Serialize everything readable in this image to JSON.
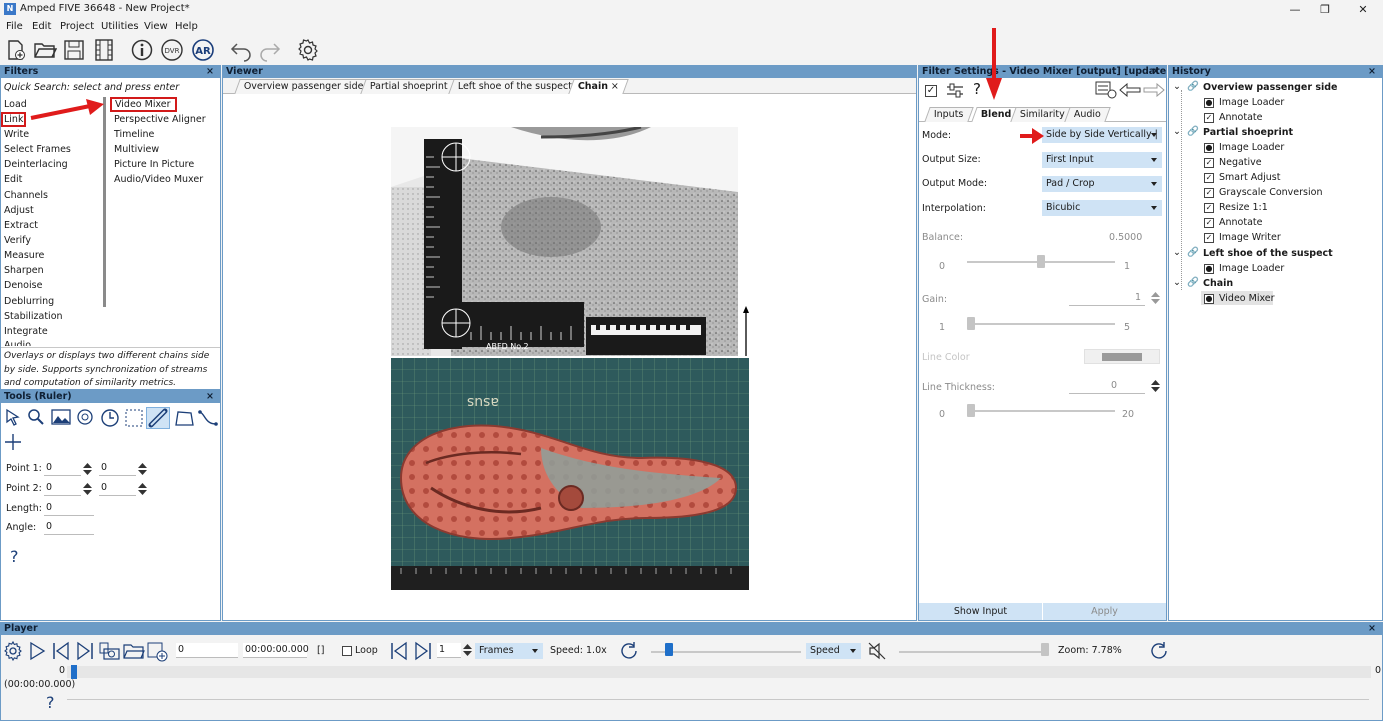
{
  "window": {
    "title": "Amped FIVE 36648 - New Project*",
    "logo_text": "N"
  },
  "menu": [
    "File",
    "Edit",
    "Project",
    "Utilities",
    "View",
    "Help"
  ],
  "toolbar_icons": [
    "new-project-icon",
    "open-icon",
    "save-icon",
    "film-icon",
    "info-icon",
    "dvr-icon",
    "ar-icon",
    "undo-icon",
    "redo-icon",
    "settings-icon"
  ],
  "filters": {
    "title": "Filters",
    "quick_search": "Quick Search: select and press enter",
    "categories": [
      "Load",
      "Link",
      "Write",
      "Select Frames",
      "Deinterlacing",
      "Edit",
      "Channels",
      "Adjust",
      "Extract",
      "Verify",
      "Measure",
      "Sharpen",
      "Denoise",
      "Deblurring",
      "Stabilization",
      "Integrate",
      "Audio"
    ],
    "items": [
      "Video Mixer",
      "Perspective Aligner",
      "Timeline",
      "Multiview",
      "Picture In Picture",
      "Audio/Video Muxer"
    ],
    "description": "Overlays or displays two different chains side by side. Supports synchronization of streams and computation of similarity metrics."
  },
  "tools": {
    "title": "Tools (Ruler)",
    "point1_label": "Point 1:",
    "point1_x": "0",
    "point1_y": "0",
    "point2_label": "Point 2:",
    "point2_x": "0",
    "point2_y": "0",
    "length_label": "Length:",
    "length": "0",
    "angle_label": "Angle:",
    "angle": "0",
    "help": "?"
  },
  "viewer": {
    "title": "Viewer",
    "tabs": [
      "Overview passenger side",
      "Partial shoeprint",
      "Left shoe of the suspect",
      "Chain"
    ],
    "active_tab": "Chain",
    "scale_text_top": "ABFD No.2",
    "mat_text": "asus"
  },
  "filter_settings": {
    "title": "Filter Settings - Video Mixer [output] [updated]",
    "tabs": [
      "Inputs",
      "Blend",
      "Similarity",
      "Audio"
    ],
    "active_tab": "Blend",
    "mode_label": "Mode:",
    "mode_value": "Side by Side Vertically |",
    "output_size_label": "Output Size:",
    "output_size_value": "First Input",
    "output_mode_label": "Output Mode:",
    "output_mode_value": "Pad / Crop",
    "interp_label": "Interpolation:",
    "interp_value": "Bicubic",
    "balance_label": "Balance:",
    "balance_value": "0.5000",
    "balance_min": "0",
    "balance_max": "1",
    "balance_level": 0.5,
    "gain_label": "Gain:",
    "gain_value": "1",
    "gain_min": "1",
    "gain_max": "5",
    "gain_level": 0.0,
    "line_color_label": "Line Color",
    "line_thickness_label": "Line Thickness:",
    "line_thickness_value": "0",
    "lt_min": "0",
    "lt_max": "20",
    "lt_level": 0.0,
    "show_input": "Show Input",
    "apply": "Apply"
  },
  "history": {
    "title": "History",
    "chains": [
      {
        "name": "Overview passenger side",
        "filters": [
          "Image Loader",
          "Annotate"
        ]
      },
      {
        "name": "Partial shoeprint",
        "filters": [
          "Image Loader",
          "Negative",
          "Smart Adjust",
          "Grayscale Conversion",
          "Resize 1:1",
          "Annotate",
          "Image Writer"
        ]
      },
      {
        "name": "Left shoe of the suspect",
        "filters": [
          "Image Loader"
        ]
      },
      {
        "name": "Chain",
        "filters": [
          "Video Mixer"
        ]
      }
    ]
  },
  "player": {
    "title": "Player",
    "frame": "0",
    "time": "00:00:00.000",
    "brackets": "[]",
    "loop_label": "Loop",
    "step": "1",
    "frames_label": "Frames",
    "speed_label": "Speed: 1.0x",
    "speed_mode": "Speed",
    "zoom_label": "Zoom: 7.78%",
    "timeline_start": "0",
    "timeline_end": "0",
    "timeline_time": "(00:00:00.000)",
    "help": "?"
  }
}
